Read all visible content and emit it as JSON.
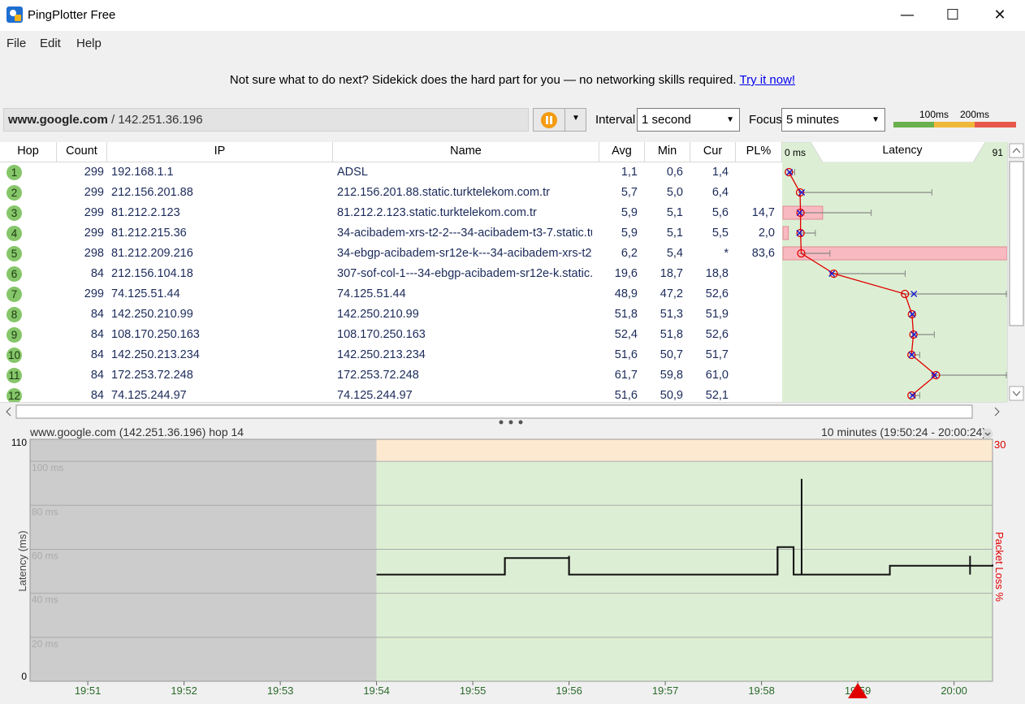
{
  "window": {
    "title": "PingPlotter Free",
    "minimize": "—",
    "maximize": "☐",
    "close": "✕"
  },
  "menu": [
    "File",
    "Edit",
    "Help"
  ],
  "sidekick": {
    "text": "Not sure what to do next? Sidekick does the hard part for you — no networking skills required.",
    "link": "Try it now!"
  },
  "target": {
    "host": "www.google.com",
    "separator": " / ",
    "ip": "142.251.36.196"
  },
  "interval": {
    "label": "Interval",
    "value": "1 second"
  },
  "focus": {
    "label": "Focus",
    "value": "5 minutes"
  },
  "scale": {
    "label1": "100ms",
    "label2": "200ms",
    "colors": [
      "#6ab04c",
      "#f0b83a",
      "#e8574c"
    ]
  },
  "columns": {
    "hop": "Hop",
    "count": "Count",
    "ip": "IP",
    "name": "Name",
    "avg": "Avg",
    "min": "Min",
    "cur": "Cur",
    "pl": "PL%",
    "lat_start": "0 ms",
    "lat_title": "Latency",
    "lat_end": "91"
  },
  "hops": [
    {
      "hop": "1",
      "count": "299",
      "ip": "192.168.1.1",
      "name": "ADSL",
      "avg": "1,1",
      "min": "0,6",
      "cur": "1,4",
      "pl": "",
      "avg_ms": 1.1,
      "min_ms": 0.6,
      "max_ms": 3.5,
      "cur_ms": 1.4,
      "pl_pct": 0
    },
    {
      "hop": "2",
      "count": "299",
      "ip": "212.156.201.88",
      "name": "212.156.201.88.static.turktelekom.com.tr",
      "avg": "5,7",
      "min": "5,0",
      "cur": "6,4",
      "pl": "",
      "avg_ms": 5.7,
      "min_ms": 5.0,
      "max_ms": 60,
      "cur_ms": 6.4,
      "pl_pct": 0
    },
    {
      "hop": "3",
      "count": "299",
      "ip": "81.212.2.123",
      "name": "81.212.2.123.static.turktelekom.com.tr",
      "avg": "5,9",
      "min": "5,1",
      "cur": "5,6",
      "pl": "14,7",
      "avg_ms": 5.9,
      "min_ms": 5.1,
      "max_ms": 35,
      "cur_ms": 5.6,
      "pl_pct": 14.7
    },
    {
      "hop": "4",
      "count": "299",
      "ip": "81.212.215.36",
      "name": "34-acibadem-xrs-t2-2---34-acibadem-t3-7.static.turktelekom.com.tr",
      "avg": "5,9",
      "min": "5,1",
      "cur": "5,5",
      "pl": "2,0",
      "avg_ms": 5.9,
      "min_ms": 5.1,
      "max_ms": 12,
      "cur_ms": 5.5,
      "pl_pct": 2.0
    },
    {
      "hop": "5",
      "count": "298",
      "ip": "81.212.209.216",
      "name": "34-ebgp-acibadem-sr12e-k---34-acibadem-xrs-t2-2.static.turktelekom.com.tr",
      "avg": "6,2",
      "min": "5,4",
      "cur": "*",
      "pl": "83,6",
      "avg_ms": 6.2,
      "min_ms": 5.4,
      "max_ms": 18,
      "cur_ms": null,
      "pl_pct": 83.6
    },
    {
      "hop": "6",
      "count": "84",
      "ip": "212.156.104.18",
      "name": "307-sof-col-1---34-ebgp-acibadem-sr12e-k.static.turktelekom.com.tr",
      "avg": "19,6",
      "min": "18,7",
      "cur": "18,8",
      "pl": "",
      "avg_ms": 19.6,
      "min_ms": 18.7,
      "max_ms": 49,
      "cur_ms": 18.8,
      "pl_pct": 0
    },
    {
      "hop": "7",
      "count": "299",
      "ip": "74.125.51.44",
      "name": "74.125.51.44",
      "avg": "48,9",
      "min": "47,2",
      "cur": "52,6",
      "pl": "",
      "avg_ms": 48.9,
      "min_ms": 47.2,
      "max_ms": 95,
      "cur_ms": 52.6,
      "pl_pct": 0
    },
    {
      "hop": "8",
      "count": "84",
      "ip": "142.250.210.99",
      "name": "142.250.210.99",
      "avg": "51,8",
      "min": "51,3",
      "cur": "51,9",
      "pl": "",
      "avg_ms": 51.8,
      "min_ms": 51.3,
      "max_ms": 53,
      "cur_ms": 51.9,
      "pl_pct": 0
    },
    {
      "hop": "9",
      "count": "84",
      "ip": "108.170.250.163",
      "name": "108.170.250.163",
      "avg": "52,4",
      "min": "51,8",
      "cur": "52,6",
      "pl": "",
      "avg_ms": 52.4,
      "min_ms": 51.8,
      "max_ms": 61,
      "cur_ms": 52.6,
      "pl_pct": 0
    },
    {
      "hop": "10",
      "count": "84",
      "ip": "142.250.213.234",
      "name": "142.250.213.234",
      "avg": "51,6",
      "min": "50,7",
      "cur": "51,7",
      "pl": "",
      "avg_ms": 51.6,
      "min_ms": 50.7,
      "max_ms": 55,
      "cur_ms": 51.7,
      "pl_pct": 0
    },
    {
      "hop": "11",
      "count": "84",
      "ip": "172.253.72.248",
      "name": "172.253.72.248",
      "avg": "61,7",
      "min": "59,8",
      "cur": "61,0",
      "pl": "",
      "avg_ms": 61.7,
      "min_ms": 59.8,
      "max_ms": 95,
      "cur_ms": 61.0,
      "pl_pct": 0
    },
    {
      "hop": "12",
      "count": "84",
      "ip": "74.125.244.97",
      "name": "74.125.244.97",
      "avg": "51,6",
      "min": "50,9",
      "cur": "52,1",
      "pl": "",
      "avg_ms": 51.6,
      "min_ms": 50.9,
      "max_ms": 55,
      "cur_ms": 52.1,
      "pl_pct": 0
    }
  ],
  "graph": {
    "title": "www.google.com (142.251.36.196) hop 14",
    "range": "10 minutes (19:50:24 - 20:00:24)",
    "ylabel": "Latency (ms)",
    "y2label": "Packet Loss %",
    "ymax_label": "110",
    "ymin_label": "0",
    "y2max_label": "30",
    "gridlines": [
      "100 ms",
      "80 ms",
      "60 ms",
      "40 ms",
      "20 ms"
    ],
    "xticks": [
      "19:51",
      "19:52",
      "19:53",
      "19:54",
      "19:55",
      "19:56",
      "19:57",
      "19:58",
      "19:59",
      "20:00"
    ],
    "colors": {
      "nodata": "#cccccc",
      "good": "#dcefd4",
      "warn": "#fde9d0",
      "line": "#111111",
      "marker": "#e00000"
    }
  },
  "chart_data": {
    "type": "line",
    "title": "www.google.com (142.251.36.196) hop 14",
    "xlabel": "",
    "ylabel": "Latency (ms)",
    "y2label": "Packet Loss %",
    "ylim": [
      0,
      110
    ],
    "y2lim": [
      0,
      30
    ],
    "x_range": [
      "19:50:24",
      "20:00:24"
    ],
    "data_start": "19:54",
    "series": [
      {
        "name": "",
        "x": [
          "19:54",
          "19:55",
          "19:55:20",
          "19:56",
          "19:57",
          "19:58",
          "19:58:10",
          "19:58:20",
          "19:58:40",
          "19:59",
          "19:59:20",
          "20:00",
          "20:00:24"
        ],
        "values": [
          48.5,
          48.5,
          56,
          48.5,
          48.5,
          48.5,
          61,
          48.5,
          48.5,
          48.5,
          52.5,
          52.5,
          53
        ]
      }
    ],
    "spikes": [
      {
        "x": "19:55:20",
        "y": 56
      },
      {
        "x": "19:56",
        "y": 57
      },
      {
        "x": "19:58:10",
        "y": 61
      },
      {
        "x": "19:58:25",
        "y": 92
      },
      {
        "x": "20:00:10",
        "y": 57
      }
    ],
    "packet_loss_marker": "19:59"
  }
}
